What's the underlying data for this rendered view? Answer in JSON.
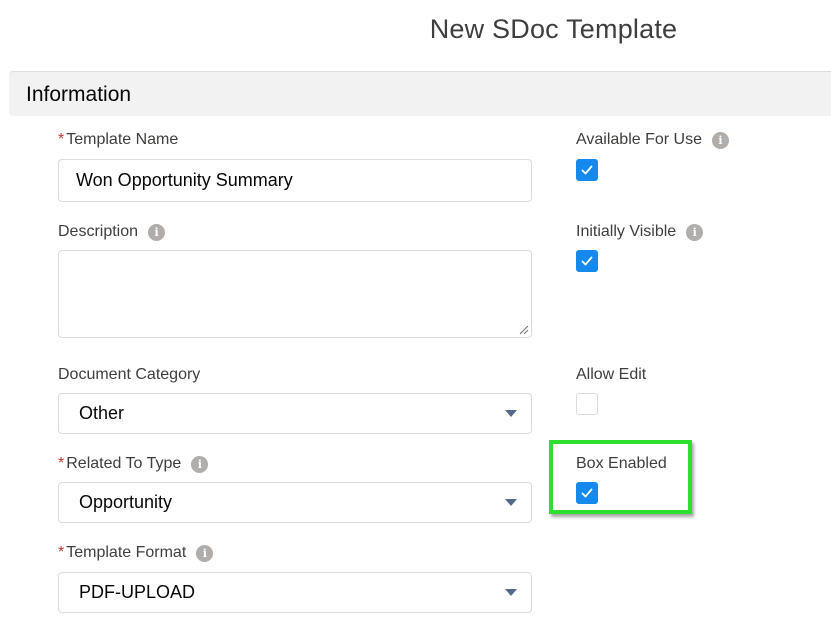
{
  "page_title": "New SDoc Template",
  "section": {
    "title": "Information"
  },
  "fields": {
    "template_name": {
      "label": "Template Name",
      "required": true,
      "value": "Won Opportunity Summary"
    },
    "description": {
      "label": "Description",
      "value": ""
    },
    "document_category": {
      "label": "Document Category",
      "value": "Other"
    },
    "related_to_type": {
      "label": "Related To Type",
      "required": true,
      "value": "Opportunity"
    },
    "template_format": {
      "label": "Template Format",
      "required": true,
      "value": "PDF-UPLOAD"
    },
    "available_for_use": {
      "label": "Available For Use",
      "checked": true
    },
    "initially_visible": {
      "label": "Initially Visible",
      "checked": true
    },
    "allow_edit": {
      "label": "Allow Edit",
      "checked": false
    },
    "box_enabled": {
      "label": "Box Enabled",
      "checked": true
    }
  },
  "required_marker": "*",
  "colors": {
    "checkbox_checked": "#1589ee",
    "required_asterisk": "#c23934",
    "highlight_border": "#2de02d",
    "section_header_bg": "#f3f2f2"
  },
  "icons": {
    "info": "info-icon",
    "dropdown": "chevron-down-icon",
    "checkmark": "checkmark-icon"
  }
}
